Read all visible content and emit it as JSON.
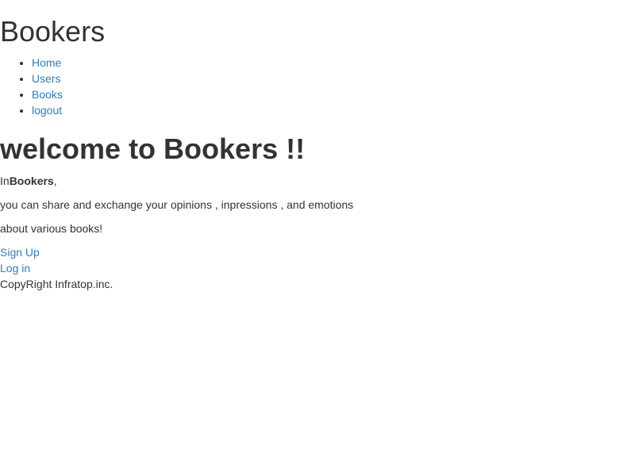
{
  "header": {
    "title": "Bookers"
  },
  "nav": {
    "items": [
      {
        "label": "Home"
      },
      {
        "label": "Users"
      },
      {
        "label": "Books"
      },
      {
        "label": "logout"
      }
    ]
  },
  "main": {
    "heading": "welcome to Bookers !!",
    "intro_prefix": "In",
    "intro_bold": "Bookers",
    "intro_suffix": ",",
    "line2": "you can share and exchange your opinions , inpressions , and emotions",
    "line3": "about various books!",
    "signup_label": "Sign Up",
    "login_label": "Log in"
  },
  "footer": {
    "copyright": "CopyRight Infratop.inc."
  },
  "colors": {
    "text": "#333333",
    "link": "#337ab7",
    "background": "#ffffff"
  }
}
